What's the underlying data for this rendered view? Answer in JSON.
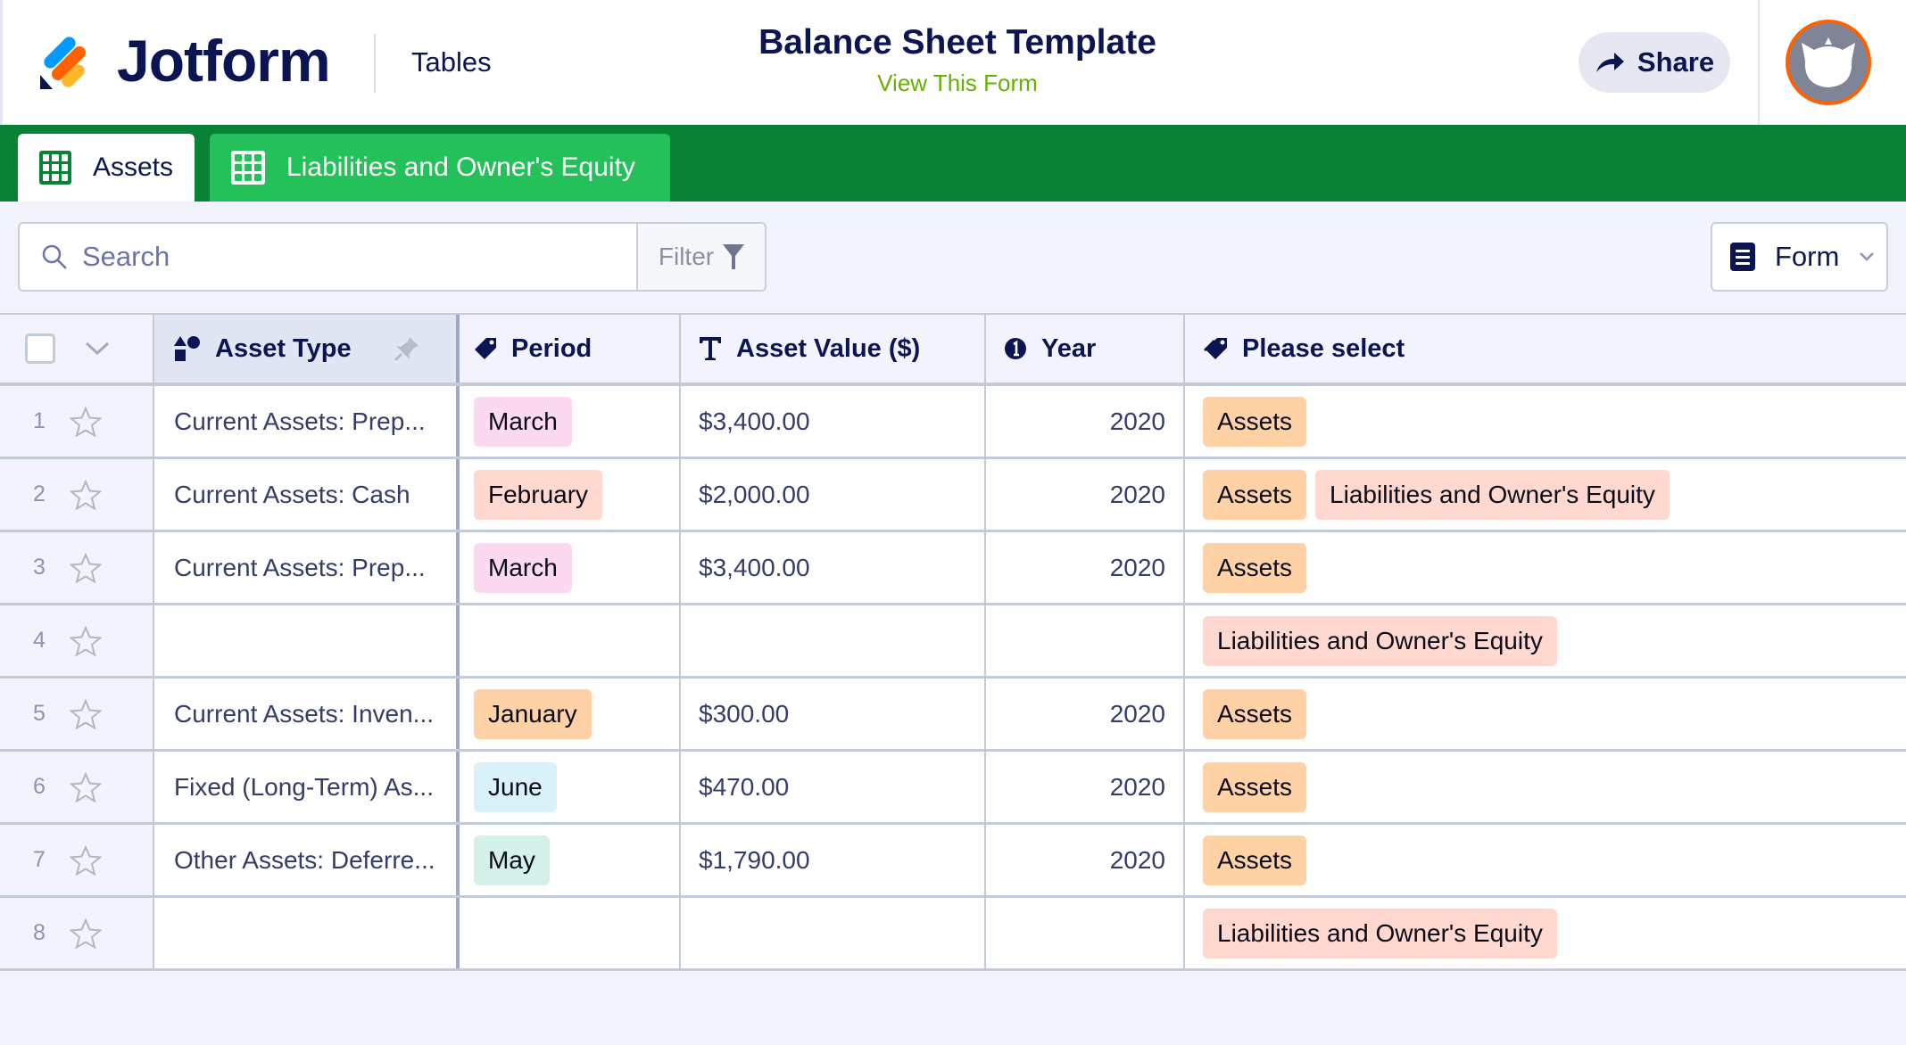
{
  "header": {
    "brand": "Jotform",
    "section": "Tables",
    "title": "Balance Sheet Template",
    "subtitle_link": "View This Form",
    "share_label": "Share"
  },
  "tabs": [
    {
      "label": "Assets",
      "active": true,
      "icon": "table-grid-icon"
    },
    {
      "label": "Liabilities and Owner's Equity",
      "active": false,
      "icon": "table-grid-icon"
    }
  ],
  "toolbar": {
    "search_placeholder": "Search",
    "search_value": "",
    "filter_label": "Filter",
    "view_selector_label": "Form"
  },
  "table": {
    "columns": [
      {
        "label": "Asset Type",
        "icon": "shapes-icon",
        "pinned": true
      },
      {
        "label": "Period",
        "icon": "tag-icon"
      },
      {
        "label": "Asset Value ($)",
        "icon": "text-type-icon"
      },
      {
        "label": "Year",
        "icon": "number-icon"
      },
      {
        "label": "Please select",
        "icon": "tags-icon"
      }
    ],
    "rows": [
      {
        "num": "1",
        "asset_type": "Current Assets: Prep...",
        "period": "March",
        "value": "$3,400.00",
        "year": "2020",
        "select": [
          "Assets"
        ]
      },
      {
        "num": "2",
        "asset_type": "Current Assets: Cash",
        "period": "February",
        "value": "$2,000.00",
        "year": "2020",
        "select": [
          "Assets",
          "Liabilities and Owner's Equity"
        ]
      },
      {
        "num": "3",
        "asset_type": "Current Assets: Prep...",
        "period": "March",
        "value": "$3,400.00",
        "year": "2020",
        "select": [
          "Assets"
        ]
      },
      {
        "num": "4",
        "asset_type": "",
        "period": "",
        "value": "",
        "year": "",
        "select": [
          "Liabilities and Owner's Equity"
        ]
      },
      {
        "num": "5",
        "asset_type": "Current Assets: Inven...",
        "period": "January",
        "value": "$300.00",
        "year": "2020",
        "select": [
          "Assets"
        ]
      },
      {
        "num": "6",
        "asset_type": "Fixed (Long-Term) As...",
        "period": "June",
        "value": "$470.00",
        "year": "2020",
        "select": [
          "Assets"
        ]
      },
      {
        "num": "7",
        "asset_type": "Other Assets: Deferre...",
        "period": "May",
        "value": "$1,790.00",
        "year": "2020",
        "select": [
          "Assets"
        ]
      },
      {
        "num": "8",
        "asset_type": "",
        "period": "",
        "value": "",
        "year": "",
        "select": [
          "Liabilities and Owner's Equity"
        ]
      }
    ]
  },
  "tag_colors": {
    "March": "#fbdaf0",
    "February": "#ffd9d0",
    "January": "#ffd2a6",
    "June": "#d9f1f8",
    "May": "#d3f1e9",
    "Assets": "#ffd2a6",
    "Liabilities and Owner's Equity": "#ffd9d0"
  },
  "colors": {
    "brand_navy": "#0a1551",
    "tab_bar_green": "#0a8236",
    "tab_inactive_green": "#24c05a",
    "link_green": "#64b201",
    "avatar_ring": "#ff6100"
  }
}
